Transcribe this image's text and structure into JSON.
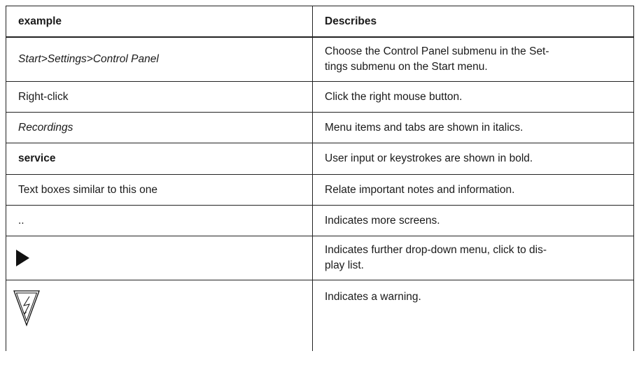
{
  "table": {
    "header": {
      "col1": "example",
      "col2": "Describes"
    },
    "rows": [
      {
        "example": "Start>Settings>Control Panel",
        "style": "italic",
        "desc": "Choose the Control Panel submenu in the Settings submenu on the Start menu.",
        "desc_line1": "Choose the Control Panel submenu in the Set-",
        "desc_line2": "tings submenu on the Start menu."
      },
      {
        "example": "Right-click",
        "style": "normal",
        "desc": "Click the right mouse button."
      },
      {
        "example": "Recordings",
        "style": "italic",
        "desc": "Menu items and tabs are shown in italics."
      },
      {
        "example": "service",
        "style": "bold",
        "desc": "User input or keystrokes are shown in bold."
      },
      {
        "example": "Text boxes similar to this one",
        "style": "normal",
        "desc": "Relate important notes and information."
      },
      {
        "example": "..",
        "style": "normal",
        "desc": "Indicates more screens."
      },
      {
        "example_icon": "right-triangle-icon",
        "desc_line1": "Indicates further drop-down menu, click to dis-",
        "desc_line2": "play list."
      },
      {
        "example_icon": "warning-lightning-triangle-icon",
        "desc": "Indicates a warning."
      }
    ]
  }
}
